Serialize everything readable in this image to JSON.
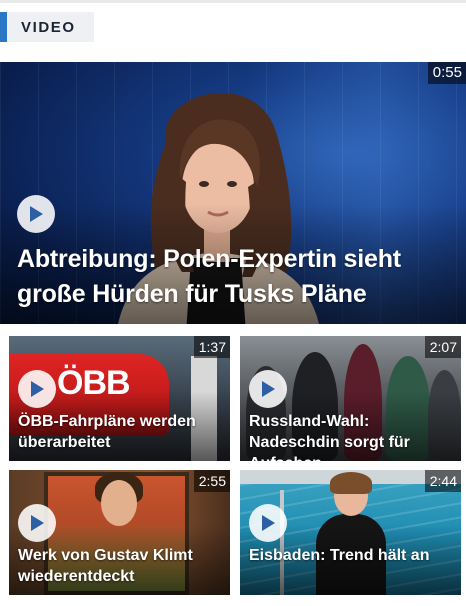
{
  "section": {
    "label": "VIDEO"
  },
  "featured": {
    "duration": "0:55",
    "title": "Abtreibung: Polen-Expertin sieht große Hürden für Tusks Pläne"
  },
  "tiles": [
    {
      "duration": "1:37",
      "title": "ÖBB-Fahrpläne werden überarbeitet",
      "image_text": "ÖBB"
    },
    {
      "duration": "2:07",
      "title": "Russland-Wahl: Nadeschdin sorgt für Aufsehen"
    },
    {
      "duration": "2:55",
      "title": "Werk von Gustav Klimt wiederentdeckt"
    },
    {
      "duration": "2:44",
      "title": "Eisbaden: Trend hält an"
    }
  ],
  "colors": {
    "accent": "#2a78c5",
    "label_bg": "#eef0f3",
    "label_text": "#1a2432",
    "play_button": "#ffffff",
    "play_icon": "#2d5fa4"
  },
  "icons": {
    "play": "play-icon"
  }
}
